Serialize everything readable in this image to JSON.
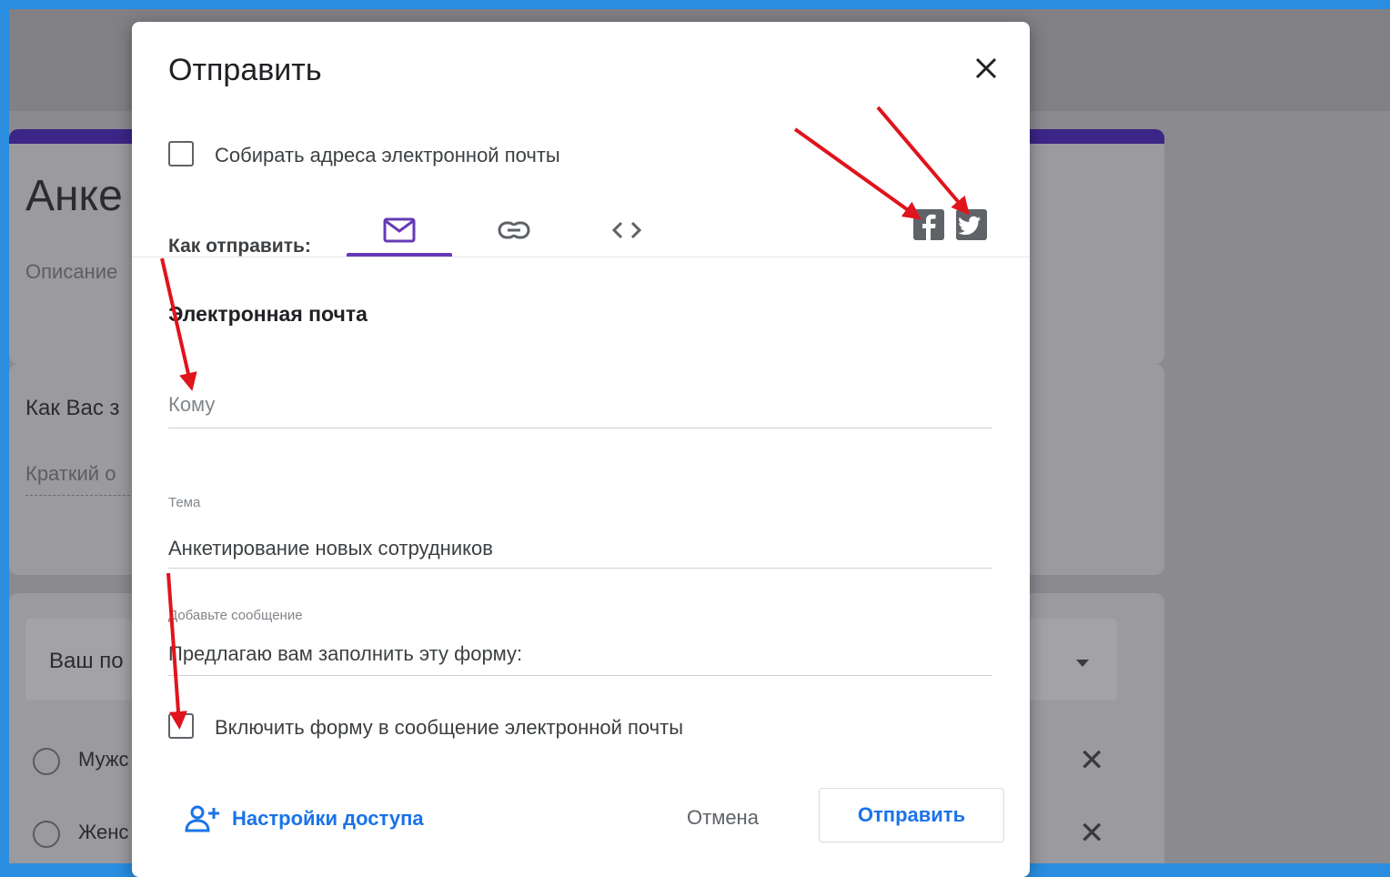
{
  "background": {
    "form_title": "Анке",
    "form_description": "Описание",
    "question1": "Как Вас з",
    "short_answer": "Краткий о",
    "question2_select": "Ваш по",
    "option_male": "Мужс",
    "option_female": "Женс"
  },
  "dialog": {
    "title": "Отправить",
    "collect_emails_label": "Собирать адреса электронной почты",
    "how_to_send_label": "Как отправить:",
    "tabs": [
      {
        "icon": "mail-icon",
        "active": true
      },
      {
        "icon": "link-icon",
        "active": false
      },
      {
        "icon": "embed-code-icon",
        "active": false
      }
    ],
    "social": [
      "facebook-icon",
      "twitter-icon"
    ],
    "section_title": "Электронная почта",
    "to_placeholder": "Кому",
    "subject_label": "Тема",
    "subject_value": "Анкетирование новых сотрудников",
    "message_label": "Добавьте сообщение",
    "message_value": "Предлагаю вам заполнить эту форму:",
    "include_form_label": "Включить форму в сообщение электронной почты",
    "access_settings_label": "Настройки доступа",
    "cancel_label": "Отмена",
    "send_label": "Отправить"
  },
  "colors": {
    "accent": "#673ab7",
    "link": "#1a73e8",
    "annotation_arrow": "#e0141c"
  }
}
